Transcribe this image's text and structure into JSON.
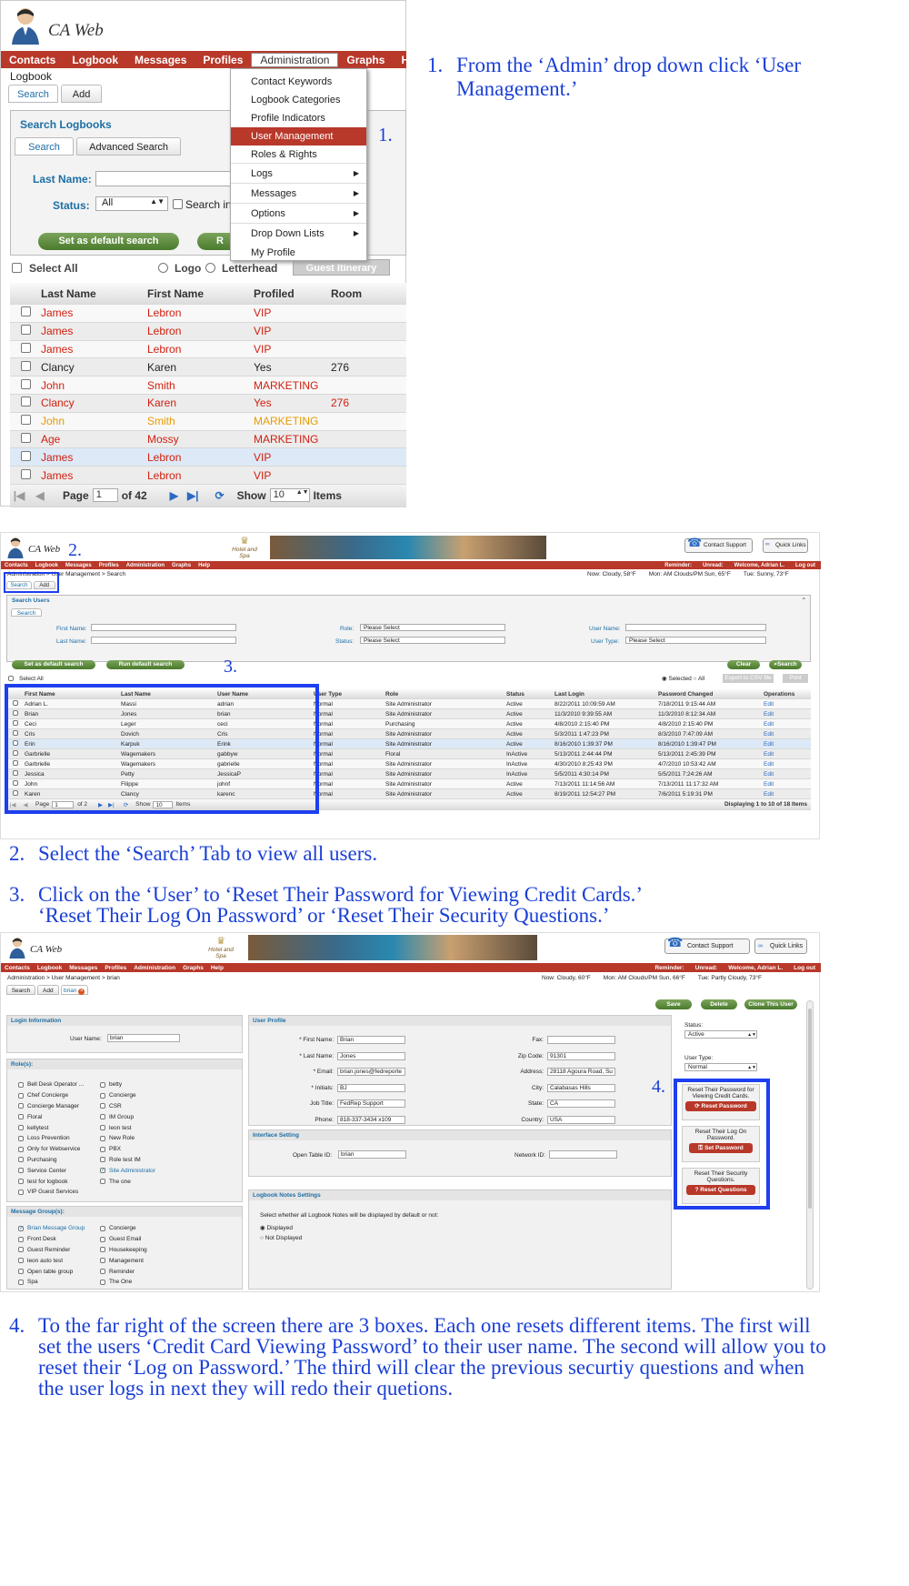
{
  "app": {
    "name": "CA Web"
  },
  "nav": [
    "Contacts",
    "Logbook",
    "Messages",
    "Profiles",
    "Administration",
    "Graphs",
    "Help"
  ],
  "s1": {
    "crumb": "Logbook",
    "tabs": [
      "Search",
      "Add"
    ],
    "panel_title": "Search Logbooks",
    "subtabs": [
      "Search",
      "Advanced Search"
    ],
    "last_name_label": "Last Name:",
    "status_label": "Status:",
    "status_value": "All",
    "search_in": "Search in",
    "default_btn": "Set as default search",
    "run_btn": "R",
    "select_all": "Select All",
    "logo": "Logo",
    "letterhead": "Letterhead",
    "guest_itin": "Guest Itinerary",
    "columns": [
      "Last Name",
      "First Name",
      "Profiled",
      "Room"
    ],
    "rows": [
      {
        "last": "James",
        "first": "Lebron",
        "prof": "VIP",
        "room": "",
        "c": "red"
      },
      {
        "last": "James",
        "first": "Lebron",
        "prof": "VIP",
        "room": "",
        "c": "red"
      },
      {
        "last": "James",
        "first": "Lebron",
        "prof": "VIP",
        "room": "",
        "c": "red"
      },
      {
        "last": "Clancy",
        "first": "Karen",
        "prof": "Yes",
        "room": "276",
        "c": "black"
      },
      {
        "last": "John",
        "first": "Smith",
        "prof": "MARKETING",
        "room": "",
        "c": "red"
      },
      {
        "last": "Clancy",
        "first": "Karen",
        "prof": "Yes",
        "room": "276",
        "c": "red"
      },
      {
        "last": "John",
        "first": "Smith",
        "prof": "MARKETING",
        "room": "",
        "c": "org"
      },
      {
        "last": "Age",
        "first": "Mossy",
        "prof": "MARKETING",
        "room": "",
        "c": "red"
      },
      {
        "last": "James",
        "first": "Lebron",
        "prof": "VIP",
        "room": "",
        "c": "red"
      },
      {
        "last": "James",
        "first": "Lebron",
        "prof": "VIP",
        "room": "",
        "c": "red"
      }
    ],
    "page_label": "Page",
    "page": "1",
    "of": "of 42",
    "show": "Show",
    "show_n": "10",
    "items": "Items",
    "menu": [
      "Contact Keywords",
      "Logbook Categories",
      "Profile Indicators",
      "User Management",
      "Roles & Rights",
      "Logs",
      "Messages",
      "Options",
      "Drop Down Lists",
      "My Profile"
    ],
    "marker": "1."
  },
  "step1": {
    "num": "1.",
    "text": "From the ‘Admin’ drop down click ‘User Management.’"
  },
  "s2": {
    "marker2": "2.",
    "marker3": "3.",
    "support": "Contact Support",
    "quick": "Quick Links",
    "hotel": "Hotel and Spa",
    "reminder": "Reminder:",
    "unread": "Unread:",
    "welcome": "Welcome, Adrian L.",
    "logout": "Log out",
    "crumb": "Administration > User Management > Search",
    "weather": [
      "Now: Cloudy, 58°F",
      "Mon: AM Clouds/PM Sun, 65°F",
      "Tue: Sunny, 73°F"
    ],
    "tabs": [
      "Search",
      "Add"
    ],
    "panel": "Search Users",
    "subtab": "Search",
    "fields": [
      "First Name:",
      "Last Name:",
      "Role:",
      "Status:",
      "User Name:",
      "User Type:"
    ],
    "please": "Please Select",
    "default_btn": "Set as default search",
    "run_btn": "Run default search",
    "clear": "Clear",
    "search": "Search",
    "select_all": "Select All",
    "selected": "Selected",
    "all": "All",
    "export": "Export to CSV file",
    "print": "Print",
    "columns": [
      "First Name",
      "Last Name",
      "User Name",
      "User Type",
      "Role",
      "Status",
      "Last Login",
      "Password Changed",
      "Operations"
    ],
    "rows": [
      [
        "Adrian L.",
        "Massi",
        "adrian",
        "Normal",
        "Site Administrator",
        "Active",
        "8/22/2011 10:09:59 AM",
        "7/18/2011 9:15:44 AM",
        "Edit"
      ],
      [
        "Brian",
        "Jones",
        "brian",
        "Normal",
        "Site Administrator",
        "Active",
        "11/3/2010 9:39:55 AM",
        "11/3/2010 8:12:34 AM",
        "Edit"
      ],
      [
        "Ceci",
        "Leger",
        "ceci",
        "Normal",
        "Purchasing",
        "Active",
        "4/8/2010 2:15:40 PM",
        "4/8/2010 2:15:40 PM",
        "Edit"
      ],
      [
        "Cris",
        "Dovich",
        "Cris",
        "Normal",
        "Site Administrator",
        "Active",
        "5/3/2011 1:47:23 PM",
        "8/3/2010 7:47:09 AM",
        "Edit"
      ],
      [
        "Erin",
        "Karpuk",
        "Erink",
        "Normal",
        "Site Administrator",
        "Active",
        "8/16/2010 1:39:37 PM",
        "8/16/2010 1:39:47 PM",
        "Edit"
      ],
      [
        "Garbrielle",
        "Wagemakers",
        "gabbyw",
        "Normal",
        "Floral",
        "InActive",
        "5/13/2011 2:44:44 PM",
        "5/13/2011 2:45:39 PM",
        "Edit"
      ],
      [
        "Garbrielle",
        "Wagemakers",
        "gabrielle",
        "Normal",
        "Site Administrator",
        "InActive",
        "4/30/2010 8:25:43 PM",
        "4/7/2010 10:53:42 AM",
        "Edit"
      ],
      [
        "Jessica",
        "Petty",
        "JessicaP",
        "Normal",
        "Site Administrator",
        "InActive",
        "5/5/2011 4:30:14 PM",
        "5/5/2011 7:24:26 AM",
        "Edit"
      ],
      [
        "John",
        "Filippe",
        "johnf",
        "Normal",
        "Site Administrator",
        "Active",
        "7/13/2011 11:14:56 AM",
        "7/13/2011 11:17:32 AM",
        "Edit"
      ],
      [
        "Karen",
        "Clancy",
        "karenc",
        "Normal",
        "Site Administrator",
        "Active",
        "8/19/2011 12:54:27 PM",
        "7/6/2011 5:19:31 PM",
        "Edit"
      ]
    ],
    "page_label": "Page",
    "page": "1",
    "of": "of 2",
    "show": "Show",
    "show_n": "10",
    "items": "Items",
    "displaying": "Displaying 1 to 10 of 18 Items"
  },
  "step2": {
    "num": "2.",
    "text": "Select the ‘Search’ Tab to view all users."
  },
  "step3": {
    "num": "3.",
    "line1": "Click on the ‘User’ to ‘Reset Their Password for Viewing Credit Cards.’",
    "line2": "‘Reset Their Log On Password’ or ‘Reset Their Security Questions.’"
  },
  "s3": {
    "marker4": "4.",
    "support": "Contact Support",
    "quick": "Quick Links",
    "hotel": "Hotel and Spa",
    "reminder": "Reminder:",
    "unread": "Unread:",
    "welcome": "Welcome, Adrian L.",
    "logout": "Log out",
    "crumb": "Administration > User Management > brian",
    "weather": [
      "Now: Cloudy, 60°F",
      "Mon: AM Clouds/PM Sun, 66°F",
      "Tue: Partly Cloudy, 73°F"
    ],
    "tabs": [
      "Search",
      "Add",
      "brian"
    ],
    "save": "Save",
    "delete": "Delete",
    "clone": "Clone This User",
    "login_info": "Login Information",
    "user_name_label": "User Name:",
    "user_name": "brian",
    "roles": "Role(s):",
    "roles_left": [
      "Bell Desk Operator ...",
      "Chef Concierge",
      "Concierge Manager",
      "Floral",
      "kellytest",
      "Loss Prevention",
      "Only for Webservice",
      "Purchasing",
      "Service Center",
      "test for logbook",
      "VIP Guest Services"
    ],
    "roles_right": [
      "betty",
      "Concierge",
      "CSR",
      "IM Group",
      "leon test",
      "New Role",
      "PBX",
      "Role test IM",
      "Site Administrator",
      "The one"
    ],
    "msg_groups": "Message Group(s):",
    "mg_left": [
      "Brian Message Group",
      "Front Desk",
      "Guest Reminder",
      "leon auto test",
      "Open table group",
      "Spa"
    ],
    "mg_right": [
      "Concierge",
      "Guest Email",
      "Housekeeping",
      "Management",
      "Reminder",
      "The One"
    ],
    "user_profile": "User Profile",
    "prof_left": [
      [
        "* First Name:",
        "Brian"
      ],
      [
        "* Last Name:",
        "Jones"
      ],
      [
        "* Email:",
        "brian.jones@fedreporte"
      ],
      [
        "* Initials:",
        "BJ"
      ],
      [
        "Job Title:",
        "FedRep Support"
      ],
      [
        "Phone:",
        "818-337-3434 x109"
      ]
    ],
    "prof_right": [
      [
        "Fax:",
        ""
      ],
      [
        "Zip Code:",
        "91301"
      ],
      [
        "Address:",
        "28118 Agoura Road, Su"
      ],
      [
        "City:",
        "Calabasas Hills"
      ],
      [
        "State:",
        "CA"
      ],
      [
        "Country:",
        "USA"
      ]
    ],
    "interface": "Interface Setting",
    "open_table": "Open Table ID:",
    "open_table_v": "brian",
    "network": "Network ID:",
    "lb_notes": "Logbook Notes Settings",
    "lb_notes_q": "Select whether all Logbook Notes will be displayed by default or not:",
    "displayed": "Displayed",
    "not_displayed": "Not Displayed",
    "status_label": "Status:",
    "status": "Active",
    "type_label": "User Type:",
    "type": "Normal",
    "box1": "Reset Their Password for Viewing Credit Cards.",
    "box1_btn": "Reset Password",
    "box2": "Reset Their Log On Password.",
    "box2_btn": "Set Password",
    "box3": "Reset Their Security Questions.",
    "box3_btn": "Reset Questions"
  },
  "step4": {
    "num": "4.",
    "lines": [
      "To the far right of the screen there are 3 boxes.  Each one resets different items.  The first will",
      "set the users ‘Credit Card Viewing Password’ to their user name.  The second will allow you to",
      "reset their ‘Log on Password.’  The third will clear the previous securtiy questions and when",
      "the user logs in next they will redo their quetions."
    ]
  }
}
